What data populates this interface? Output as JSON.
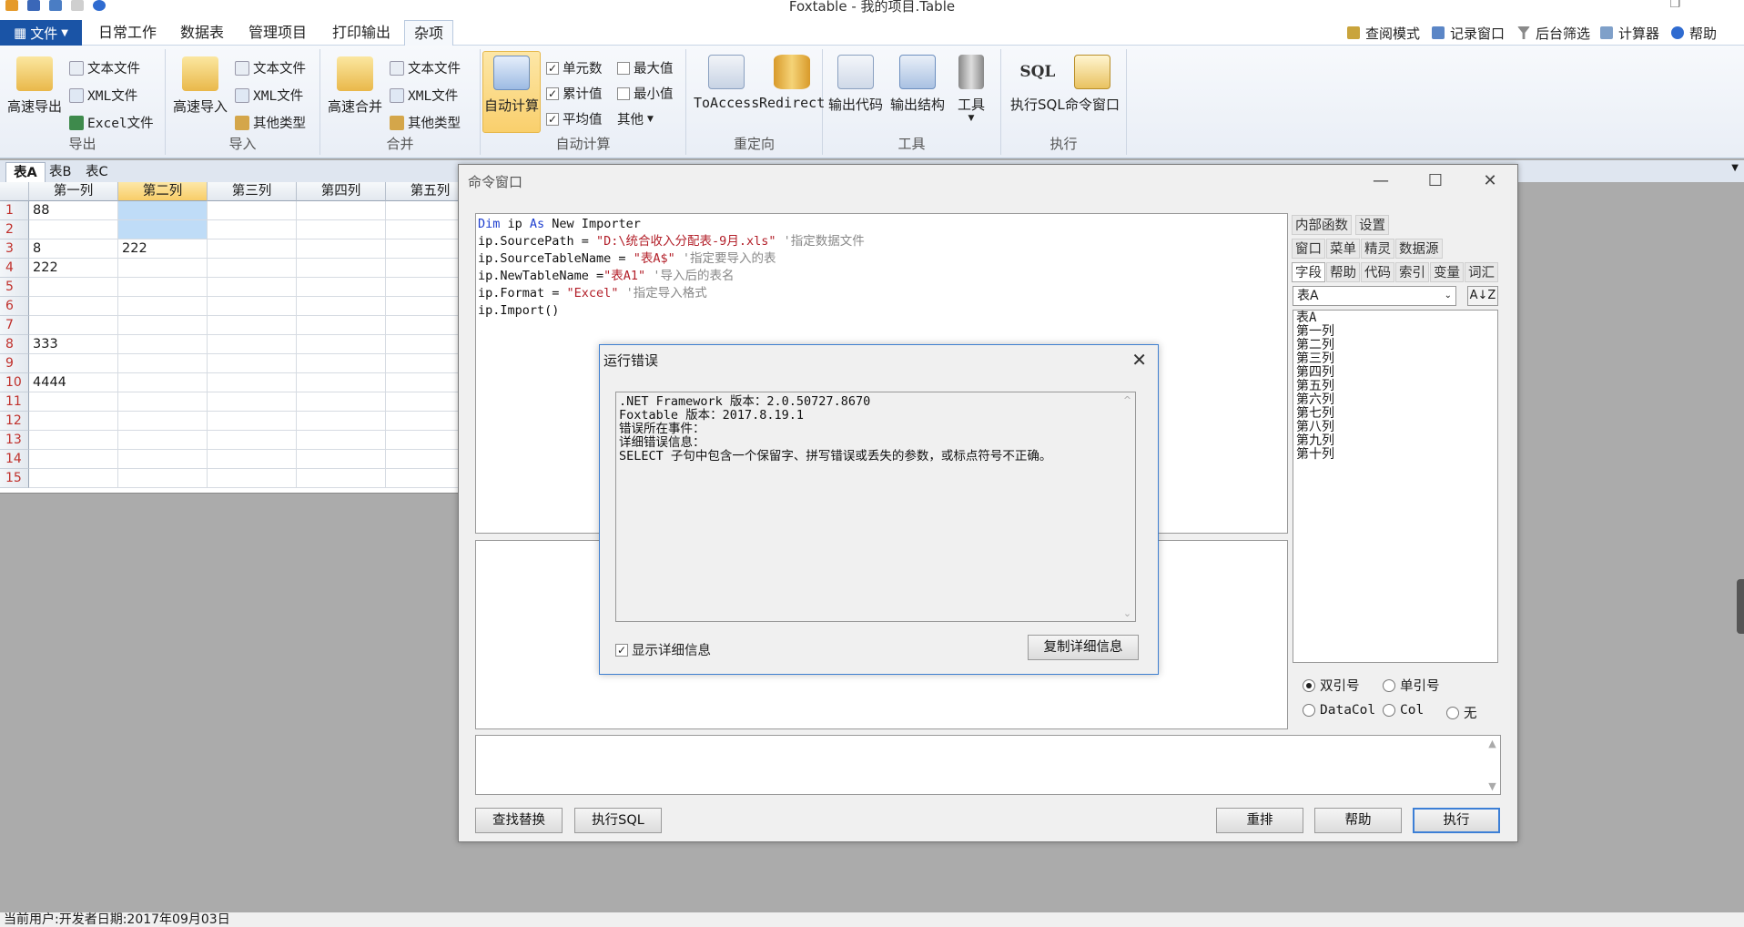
{
  "window": {
    "title": "Foxtable - 我的项目.Table",
    "restore_icon": "restore-icon"
  },
  "colors": {
    "file_button": "#1a54a6",
    "selected_header": "#f9cf6c",
    "selection": "#bfdcf7",
    "row_number": "#c0302b",
    "accent_border": "#3e7fd0"
  },
  "ribbon": {
    "file_label": "文件",
    "tabs": [
      "日常工作",
      "数据表",
      "管理项目",
      "打印输出",
      "杂项"
    ],
    "selected_tab": "杂项",
    "right_items": [
      "查阅模式",
      "记录窗口",
      "后台筛选",
      "计算器",
      "帮助"
    ],
    "groups": {
      "export": {
        "label": "导出",
        "big": "高速导出",
        "items": [
          "文本文件",
          "XML文件",
          "Excel文件"
        ]
      },
      "import": {
        "label": "导入",
        "big": "高速导入",
        "items": [
          "文本文件",
          "XML文件",
          "其他类型"
        ]
      },
      "merge": {
        "label": "合并",
        "big": "高速合并",
        "items": [
          "文本文件",
          "XML文件",
          "其他类型"
        ]
      },
      "autocalc": {
        "label": "自动计算",
        "big": "自动计算",
        "checks": [
          "单元数",
          "累计值",
          "平均值"
        ],
        "unchecked": [
          "最大值",
          "最小值"
        ],
        "other": "其他"
      },
      "redirect": {
        "label": "重定向",
        "items": [
          "ToAccess",
          "Redirect"
        ]
      },
      "tools": {
        "label": "工具",
        "items": [
          "输出代码",
          "输出结构",
          "工具"
        ]
      },
      "execute": {
        "label": "执行",
        "items": [
          "执行SQL",
          "命令窗口"
        ]
      }
    }
  },
  "sheet_tabs": [
    "表A",
    "表B",
    "表C"
  ],
  "grid": {
    "columns": [
      "第一列",
      "第二列",
      "第三列",
      "第四列",
      "第五列"
    ],
    "rows": [
      "1",
      "2",
      "3",
      "4",
      "5",
      "6",
      "7",
      "8",
      "9",
      "10",
      "11",
      "12",
      "13",
      "14",
      "15"
    ],
    "cells": {
      "r1c1": "88",
      "r3c1": "8",
      "r3c2": "222",
      "r4c1": "222",
      "r8c1": "333",
      "r10c1": "4444"
    }
  },
  "command_window": {
    "title": "命令窗口",
    "code": {
      "l1a": "Dim",
      "l1b": " ip ",
      "l1c": "As",
      "l1d": " New Importer",
      "l2a": "ip.SourcePath = ",
      "l2b": "\"D:\\统合收入分配表-9月.xls\"",
      "l2c": " '指定数据文件",
      "l3a": "ip.SourceTableName = ",
      "l3b": "\"表A$\"",
      "l3c": " '指定要导入的表",
      "l4a": "ip.NewTableName =",
      "l4b": "\"表A1\"",
      "l4c": " '导入后的表名",
      "l5a": "ip.Format = ",
      "l5b": "\"Excel\"",
      "l5c": " '指定导入格式",
      "l6": "ip.Import()"
    },
    "panel_tabs_row1": [
      "内部函数",
      "设置"
    ],
    "panel_tabs_row2": [
      "窗口",
      "菜单",
      "精灵",
      "数据源"
    ],
    "panel_tabs_row3": [
      "字段",
      "帮助",
      "代码",
      "索引",
      "变量",
      "词汇"
    ],
    "table_select": "表A",
    "fields": [
      "表A",
      "第一列",
      "第二列",
      "第三列",
      "第四列",
      "第五列",
      "第六列",
      "第七列",
      "第八列",
      "第九列",
      "第十列"
    ],
    "quote_options": [
      "双引号",
      "单引号",
      "DataCol",
      "Col",
      "无"
    ],
    "buttons": {
      "find": "查找替换",
      "sql": "执行SQL",
      "reset": "重排",
      "help": "帮助",
      "run": "执行"
    }
  },
  "error_dialog": {
    "title": "运行错误",
    "lines": [
      ".NET Framework 版本：2.0.50727.8670",
      "Foxtable 版本：2017.8.19.1",
      "错误所在事件：",
      "详细错误信息：",
      "SELECT 子句中包含一个保留字、拼写错误或丢失的参数，或标点符号不正确。"
    ],
    "show_details": "显示详细信息",
    "copy_button": "复制详细信息"
  },
  "status_bar": {
    "text": "当前用户:开发者日期:2017年09月03日"
  }
}
